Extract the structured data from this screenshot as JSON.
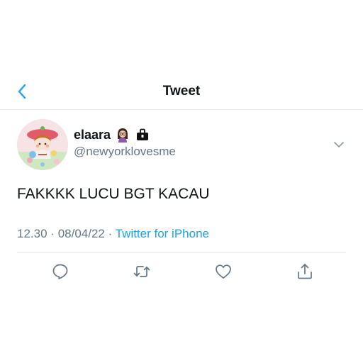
{
  "header": {
    "title": "Tweet",
    "back_icon": "chevron-left-icon",
    "accent_color": "#1da1f2"
  },
  "tweet": {
    "display_name": "elaara",
    "name_emojis": [
      "woman-with-glasses-emoji",
      "locked-briefcase-emoji"
    ],
    "handle": "@newyorklovesme",
    "text": "FAKKKK LUCU BGT KACAU",
    "time": "12.30",
    "date": "08/04/22",
    "separator": "·",
    "source": "Twitter for iPhone"
  },
  "actions": [
    {
      "icon": "reply-icon"
    },
    {
      "icon": "retweet-icon"
    },
    {
      "icon": "like-icon"
    },
    {
      "icon": "share-icon"
    }
  ]
}
